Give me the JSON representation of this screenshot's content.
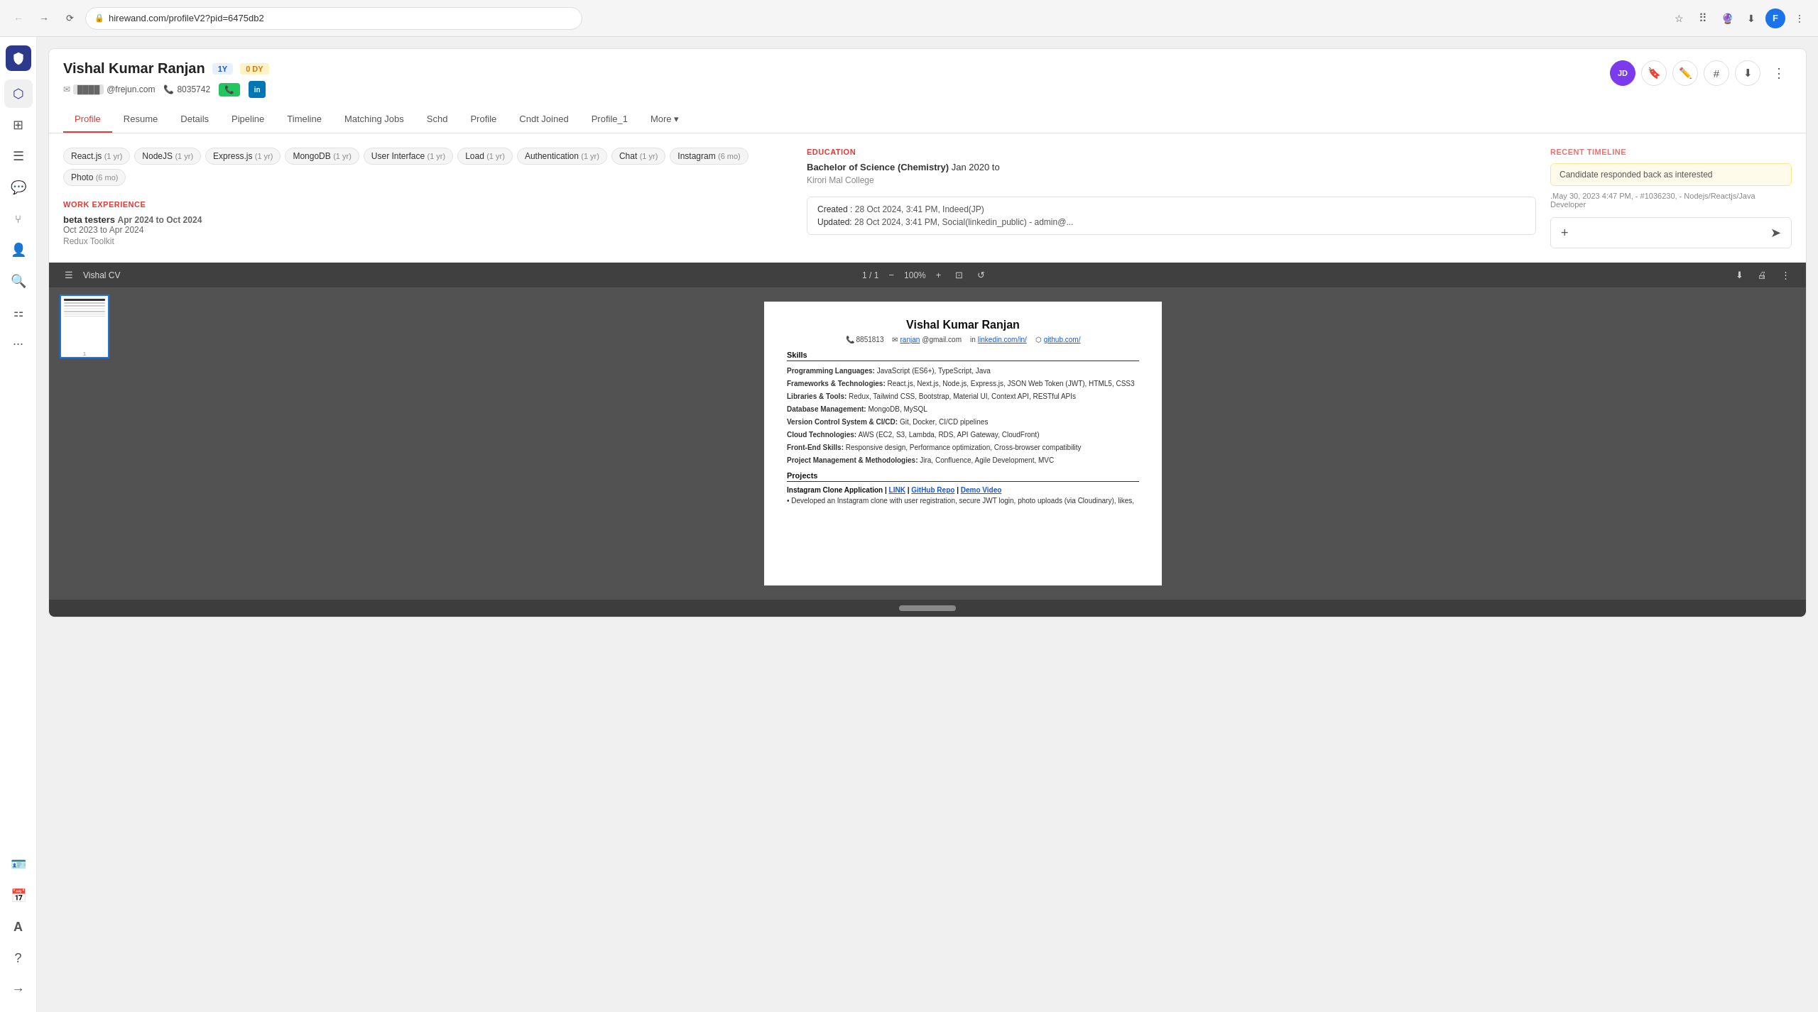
{
  "browser": {
    "url": "hirewand.com/profileV2?pid=6475db2",
    "user_initial": "F"
  },
  "sidebar": {
    "items": [
      {
        "label": "Home",
        "icon": "⬡",
        "active": false
      },
      {
        "label": "Dashboard",
        "icon": "⊞",
        "active": false
      },
      {
        "label": "List",
        "icon": "☰",
        "active": false
      },
      {
        "label": "Messages",
        "icon": "💬",
        "active": false
      },
      {
        "label": "Network",
        "icon": "⑂",
        "active": false
      },
      {
        "label": "People",
        "icon": "👤",
        "active": false
      },
      {
        "label": "Search",
        "icon": "🔍",
        "active": false
      },
      {
        "label": "Analytics",
        "icon": "≡",
        "active": false
      },
      {
        "label": "More",
        "icon": "···",
        "active": false
      }
    ],
    "bottom_items": [
      {
        "label": "Profile Pic",
        "icon": "👤"
      },
      {
        "label": "Calendar",
        "icon": "📅"
      },
      {
        "label": "Font",
        "icon": "A"
      },
      {
        "label": "Help",
        "icon": "?"
      },
      {
        "label": "Arrow",
        "icon": "→"
      }
    ]
  },
  "profile": {
    "name": "Vishal Kumar Ranjan",
    "badge_1y": "1Y",
    "badge_0dy": "0 DY",
    "email_masked": "████",
    "email_domain": "@frejun.com",
    "phone": "8035742",
    "toolbar": {
      "jd_label": "JD",
      "bookmark_icon": "🔖",
      "edit_icon": "✏️",
      "tag_icon": "#",
      "download_icon": "⬇",
      "more_icon": "⋮"
    },
    "tabs": [
      {
        "label": "Profile",
        "active": true
      },
      {
        "label": "Resume",
        "active": false
      },
      {
        "label": "Details",
        "active": false
      },
      {
        "label": "Pipeline",
        "active": false
      },
      {
        "label": "Timeline",
        "active": false
      },
      {
        "label": "Matching Jobs",
        "active": false
      },
      {
        "label": "Schd",
        "active": false
      },
      {
        "label": "Profile",
        "active": false
      },
      {
        "label": "Cndt Joined",
        "active": false
      },
      {
        "label": "Profile_1",
        "active": false
      },
      {
        "label": "More ▾",
        "active": false
      }
    ],
    "skills": [
      {
        "name": "React.js",
        "duration": "1 yr"
      },
      {
        "name": "NodeJS",
        "duration": "1 yr"
      },
      {
        "name": "Express.js",
        "duration": "1 yr"
      },
      {
        "name": "MongoDB",
        "duration": "1 yr"
      },
      {
        "name": "User Interface",
        "duration": "1 yr"
      },
      {
        "name": "Load",
        "duration": "1 yr"
      },
      {
        "name": "Authentication",
        "duration": "1 yr"
      },
      {
        "name": "Chat",
        "duration": "1 yr"
      },
      {
        "name": "Instagram",
        "duration": "6 mo"
      },
      {
        "name": "Photo",
        "duration": "6 mo"
      }
    ],
    "work_experience": {
      "section_title": "WORK EXPERIENCE",
      "jobs": [
        {
          "company": "beta testers",
          "dates": "Apr 2024 to Oct 2024"
        },
        {
          "dates2": "Oct 2023 to Apr 2024",
          "tech": "Redux Toolkit"
        }
      ]
    },
    "education": {
      "section_title": "EDUCATION",
      "degree": "Bachelor of Science (Chemistry)",
      "dates": "Jan 2020 to",
      "college": "Kirori Mal College"
    },
    "meta": {
      "created_label": "Created :",
      "created_value": "28 Oct 2024, 3:41 PM, Indeed(JP)",
      "updated_label": "Updated:",
      "updated_value": "28 Oct 2024, 3:41 PM, Social(linkedin_public) - admin@..."
    },
    "recent_timeline": {
      "section_title": "RECENT TIMELINE",
      "event": "Candidate responded back as interested",
      "meta": ".May 30, 2023 4:47 PM, - #1036230, - Nodejs/Reactjs/Java Developer"
    },
    "comment_placeholder": ""
  },
  "cv": {
    "title": "Vishal CV",
    "page_current": "1",
    "page_total": "1",
    "zoom": "100%",
    "doc": {
      "name": "Vishal Kumar Ranjan",
      "phone": "8851813",
      "email": "ranjan",
      "email2": "@gmail.com",
      "linkedin": "linkedin.com/in/",
      "github": "github.com/",
      "skills_title": "Skills",
      "skill_rows": [
        {
          "label": "Programming Languages:",
          "value": "JavaScript (ES6+), TypeScript, Java"
        },
        {
          "label": "Frameworks & Technologies:",
          "value": "React.js, Next.js, Node.js, Express.js, JSON Web Token (JWT), HTML5, CSS3"
        },
        {
          "label": "Libraries & Tools:",
          "value": "Redux, Tailwind CSS, Bootstrap, Material UI, Context API, RESTful APIs"
        },
        {
          "label": "Database Management:",
          "value": "MongoDB, MySQL"
        },
        {
          "label": "Version Control System & CI/CD:",
          "value": "Git, Docker, CI/CD pipelines"
        },
        {
          "label": "Cloud Technologies:",
          "value": "AWS (EC2, S3, Lambda, RDS, API Gateway, CloudFront)"
        },
        {
          "label": "Front-End Skills:",
          "value": "Responsive design, Performance optimization, Cross-browser compatibility"
        },
        {
          "label": "Project Management & Methodologies:",
          "value": "Jira, Confluence, Agile Development, MVC"
        }
      ],
      "projects_title": "Projects",
      "projects": [
        {
          "name": "Instagram Clone Application",
          "links": "LINK | GitHub Repo | Demo Video",
          "desc": "• Developed an Instagram clone with user registration, secure JWT login, photo uploads (via Cloudinary), likes,"
        }
      ]
    }
  }
}
